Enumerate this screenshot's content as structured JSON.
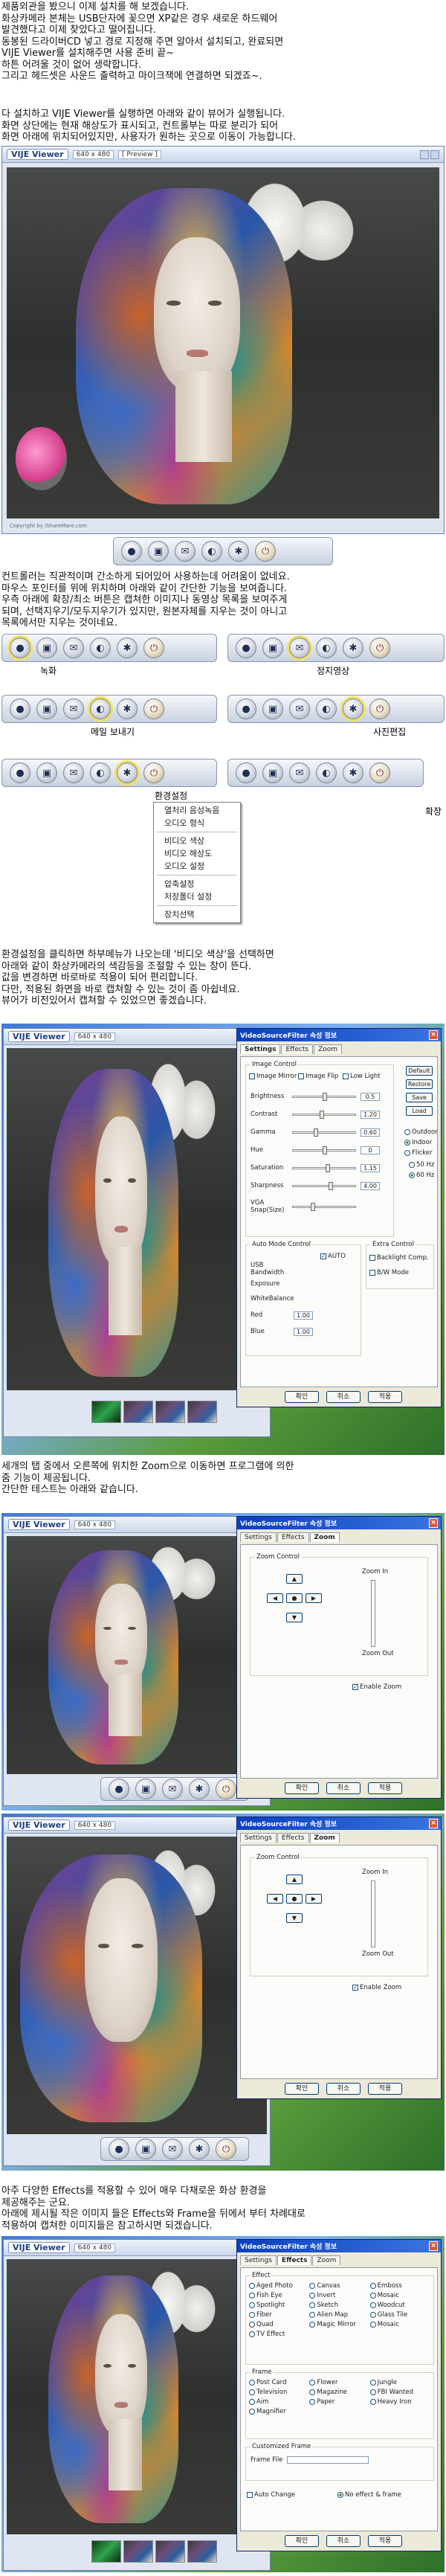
{
  "intro": [
    "제품외관을 봤으니 이제 설치를 해 보겠습니다.",
    "화상카메라 본체는 USB단자에 꽂으면 XP같은 경우 새로운 하드웨어",
    "발견했다고 이제 찾았다고 떨어집니다.",
    "동봉된 드라이버CD 넣고 경로 지정해 주면 알아서 설치되고, 완료되면",
    "VIJE Viewer를 설치해주면 사용 준비 끝~",
    "하튼 어려울 것이 없어 생략합니다.",
    "그리고 헤드셋은 사운드 출력하고 마이크잭에 연결하면 되겠죠~."
  ],
  "para2": [
    "다 설치하고 VIJE Viewer를 실행하면 아래와 같이 뷰어가 실행됩니다.",
    "화면 상단에는 현재 해상도가 표시되고, 컨트롤부는 따로 분리가 되어",
    "화면 아래에 위치되어있지만, 사용자가 원하는 곳으로 이동이 가능합니다."
  ],
  "viewer": {
    "logo": "VIJE Viewer",
    "resolution": "640 x 480",
    "preview": "[ Preview ]",
    "copyright": "Copyright by iShareMare.com"
  },
  "para3": [
    "컨트롤러는 직관적이며 간소하게 되어있어 사용하는데 어려움이 없네요.",
    "마우스 포인터를 위에 위치하며 아래와 같이 간단한 기능을 보여줍니다.",
    "우측 아래에 확장/최소 버튼은 캡쳐한 이미지나 동영상 목록을 보여주게",
    "되며, 선택지우기/모두지우기가 있지만, 원본자체를 지우는 것이 아니고",
    "목록에서만 지우는 것이네요."
  ],
  "ctrl_labels": [
    "녹화",
    "정지영상",
    "메일 보내기",
    "사진편집",
    "환경설정",
    "확장"
  ],
  "menu": {
    "items": [
      "열처리 음성녹음",
      "오디오 형식",
      "비디오 색상",
      "비디오 해상도",
      "오디오 설정",
      "압축설정",
      "저장폴더 설정",
      "장치선택"
    ],
    "selected": "열처리 음성녹음"
  },
  "para4": [
    "환경설정을 클릭하면 하부메뉴가 나오는데 '비디오 색상'을 선택하면",
    "아래와 같이 화상카메라의 색감등을 조절할 수 있는 창이 뜬다.",
    "값을 변경하면 바로바로 적용이 되어 편리합니다.",
    "다만, 적용된 화면을 바로 캡쳐할 수 있는 것이 좀 아쉽네요.",
    "뷰어가 비전있어서 캡쳐할 수 있었으면 좋겠습니다."
  ],
  "dlg_title": "VideoSourceFilter 속성 정보",
  "dlg_tabs": [
    "Settings",
    "Effects",
    "Zoom"
  ],
  "settings": {
    "group": "Image Control",
    "mirror": "Image Mirror",
    "flip": "Image Flip",
    "lowlight": "Low Light",
    "sliders": [
      {
        "label": "Brightness",
        "value": "0.5",
        "pos": 0.5
      },
      {
        "label": "Contrast",
        "value": "1.20",
        "pos": 0.45
      },
      {
        "label": "Gamma",
        "value": "0.60",
        "pos": 0.35
      },
      {
        "label": "Hue",
        "value": "0",
        "pos": 0.5
      },
      {
        "label": "Saturation",
        "value": "1.15",
        "pos": 0.55
      },
      {
        "label": "Sharpness",
        "value": "4.00",
        "pos": 0.6
      },
      {
        "label": "VGA Snap(Size)",
        "value": "",
        "pos": 0.3
      }
    ],
    "side_buttons": [
      "Default",
      "Restore",
      "Save",
      "Load"
    ],
    "side_radios": [
      "Outdoor",
      "Indoor",
      "Flicker",
      "50 Hz",
      "60 Hz"
    ],
    "auto_group": "Auto Mode Control",
    "auto": "AUTO",
    "usb": "USB Bandwidth",
    "exposure": "Exposure",
    "wb": "WhiteBalance",
    "red": "Red",
    "blue": "Blue",
    "red_val": "1.00",
    "blue_val": "1.00",
    "extra": "Extra Control",
    "backlight": "Backlight Comp.",
    "bw": "B/W Mode"
  },
  "ok": "확인",
  "cancel": "취소",
  "apply": "적용",
  "para5": [
    "세개의 탭 중에서 오른쪽에 위치한 Zoom으로 이동하면 프로그램에 의한",
    "줌 기능이 제공됩니다.",
    "간단한 테스트는 아래와 같습니다."
  ],
  "zoom": {
    "group": "Zoom Control",
    "zoomin": "Zoom In",
    "zoomout": "Zoom Out",
    "enable": "Enable Zoom"
  },
  "para6": [
    "아주 다양한 Effects를 적용할 수 있어 매우 다채로운 화상 환경을",
    "제공해주는 군요.",
    "아래에 제시될 작은 이미지 들은 Effects와 Frame을 뒤에서 부터 차례대로",
    "적용하여 캡쳐한 이미지들은 참고하시면 되겠습니다."
  ],
  "effects": {
    "group1": "Effect",
    "items1": [
      "Aged Photo",
      "Canvas",
      "Emboss",
      "Fish Eye",
      "Invert",
      "Mosaic",
      "Spotlight",
      "Sketch",
      "Woodcut",
      "Fiber",
      "Alien Map",
      "Glass Tile",
      "Quad",
      "Magic Mirror",
      "Mosaic",
      "TV Effect"
    ],
    "group2": "Frame",
    "items2": [
      "Post Card",
      "Flower",
      "Jungle",
      "Television",
      "Magazine",
      "FBI Wanted",
      "Aim",
      "Paper",
      "Heavy Iron",
      "Magnifier"
    ],
    "group3": "Customized Frame",
    "frame_file": "Frame File",
    "auto_change": "Auto Change",
    "no_effect": "No effect & frame"
  }
}
